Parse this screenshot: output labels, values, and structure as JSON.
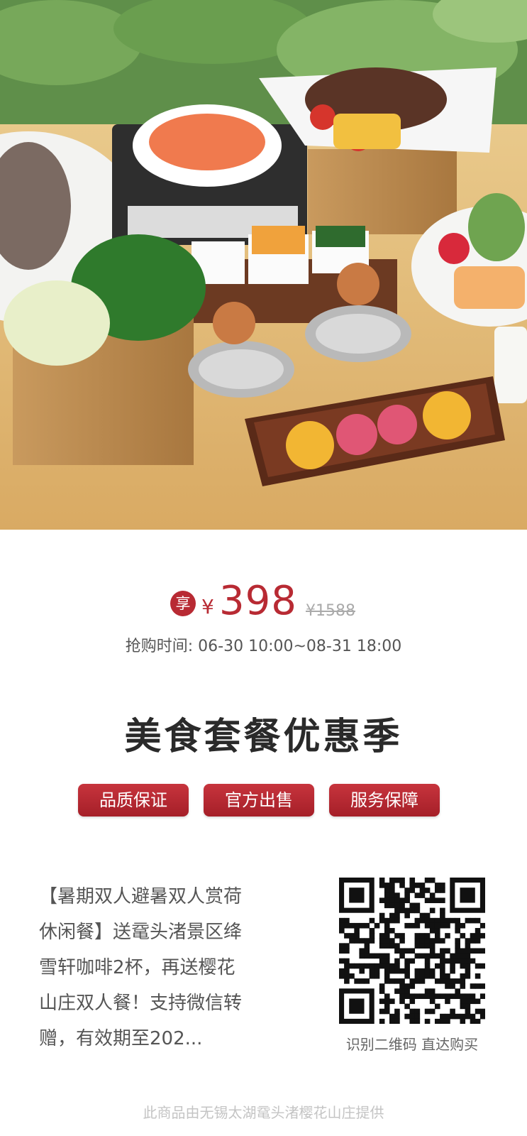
{
  "hero": {
    "image_label": "food-spread-photo"
  },
  "price": {
    "badge": "享",
    "currency": "¥",
    "value": "398",
    "original": "¥1588"
  },
  "sale_time": "抢购时间: 06-30 10:00~08-31 18:00",
  "title": "美食套餐优惠季",
  "tags": [
    "品质保证",
    "官方出售",
    "服务保障"
  ],
  "description_lines": [
    "【暑期双人避暑双人赏荷",
    "休闲餐】送鼋头渚景区绛",
    "雪轩咖啡2杯，再送樱花",
    "山庄双人餐！支持微信转",
    "赠，有效期至202..."
  ],
  "qr_caption": "识别二维码 直达购买",
  "footer": "此商品由无锡太湖鼋头渚樱花山庄提供",
  "colors": {
    "accent": "#b82a33",
    "muted": "#aaaaaa"
  }
}
